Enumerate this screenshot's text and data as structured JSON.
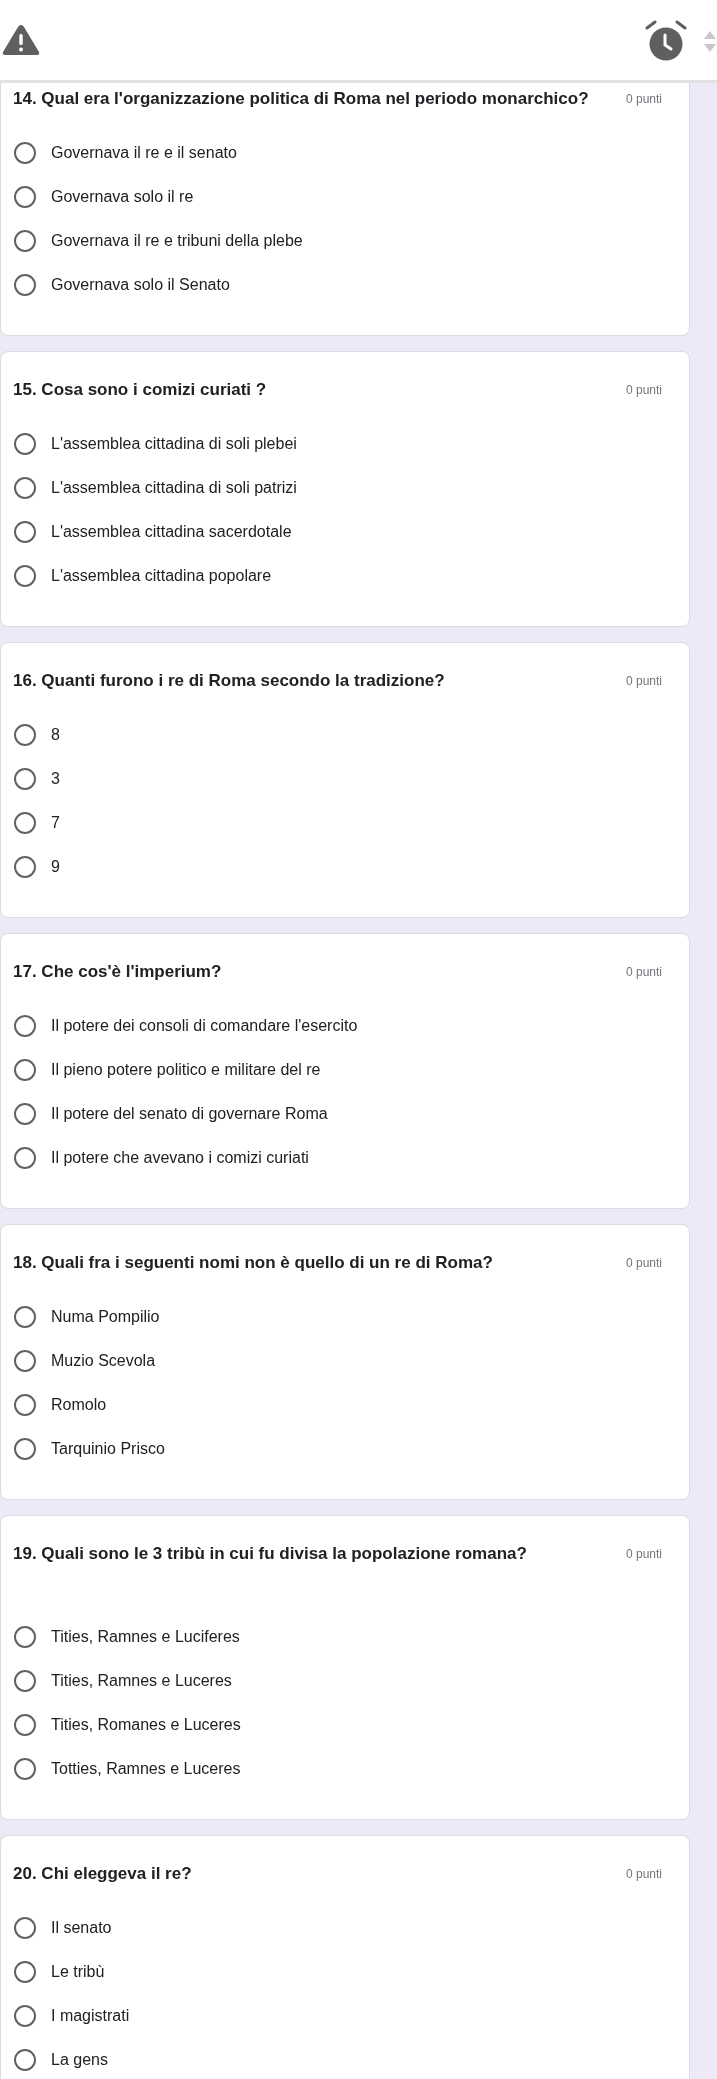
{
  "header": {
    "scroll_arrows": true
  },
  "questions": [
    {
      "title": "14. Qual era l'organizzazione politica di Roma nel periodo monarchico?",
      "points": "0 punti",
      "options": [
        {
          "label": "Governava il re e il senato",
          "selected": false
        },
        {
          "label": "Governava solo il re",
          "selected": false
        },
        {
          "label": "Governava il re e tribuni della plebe",
          "selected": false
        },
        {
          "label": "Governava solo il Senato",
          "selected": false
        }
      ]
    },
    {
      "title": "15. Cosa sono i comizi curiati ?",
      "points": "0 punti",
      "options": [
        {
          "label": "L'assemblea cittadina di soli plebei",
          "selected": false
        },
        {
          "label": "L'assemblea cittadina di soli patrizi",
          "selected": false
        },
        {
          "label": "L'assemblea cittadina sacerdotale",
          "selected": false
        },
        {
          "label": "L'assemblea cittadina popolare",
          "selected": false
        }
      ]
    },
    {
      "title": "16. Quanti furono i re di Roma secondo la tradizione?",
      "points": "0 punti",
      "options": [
        {
          "label": "8",
          "selected": false
        },
        {
          "label": "3",
          "selected": false
        },
        {
          "label": "7",
          "selected": false
        },
        {
          "label": "9",
          "selected": false
        }
      ]
    },
    {
      "title": "17. Che cos'è l'imperium?",
      "points": "0 punti",
      "options": [
        {
          "label": "Il potere dei consoli di comandare l'esercito",
          "selected": false
        },
        {
          "label": "Il pieno potere politico e militare del re",
          "selected": false
        },
        {
          "label": "Il potere del senato di governare Roma",
          "selected": false
        },
        {
          "label": "Il potere che avevano i comizi curiati",
          "selected": false
        }
      ]
    },
    {
      "title": "18. Quali fra i seguenti nomi non è quello di un re di Roma?",
      "points": "0 punti",
      "options": [
        {
          "label": "Numa Pompilio",
          "selected": false
        },
        {
          "label": "Muzio Scevola",
          "selected": false
        },
        {
          "label": "Romolo",
          "selected": false
        },
        {
          "label": "Tarquinio Prisco",
          "selected": false
        }
      ]
    },
    {
      "title": "19. Quali sono le 3 tribù in cui fu divisa la popolazione romana?",
      "points": "0 punti",
      "options": [
        {
          "label": "Tities, Ramnes e Luciferes",
          "selected": false
        },
        {
          "label": "Tities, Ramnes e Luceres",
          "selected": false
        },
        {
          "label": "Tities, Romanes e Luceres",
          "selected": false
        },
        {
          "label": "Totties, Ramnes e Luceres",
          "selected": false
        }
      ]
    },
    {
      "title": "20. Chi eleggeva il re?",
      "points": "0 punti",
      "options": [
        {
          "label": "Il senato",
          "selected": false
        },
        {
          "label": "Le tribù",
          "selected": false
        },
        {
          "label": "I magistrati",
          "selected": false
        },
        {
          "label": "La gens",
          "selected": false
        }
      ]
    }
  ]
}
